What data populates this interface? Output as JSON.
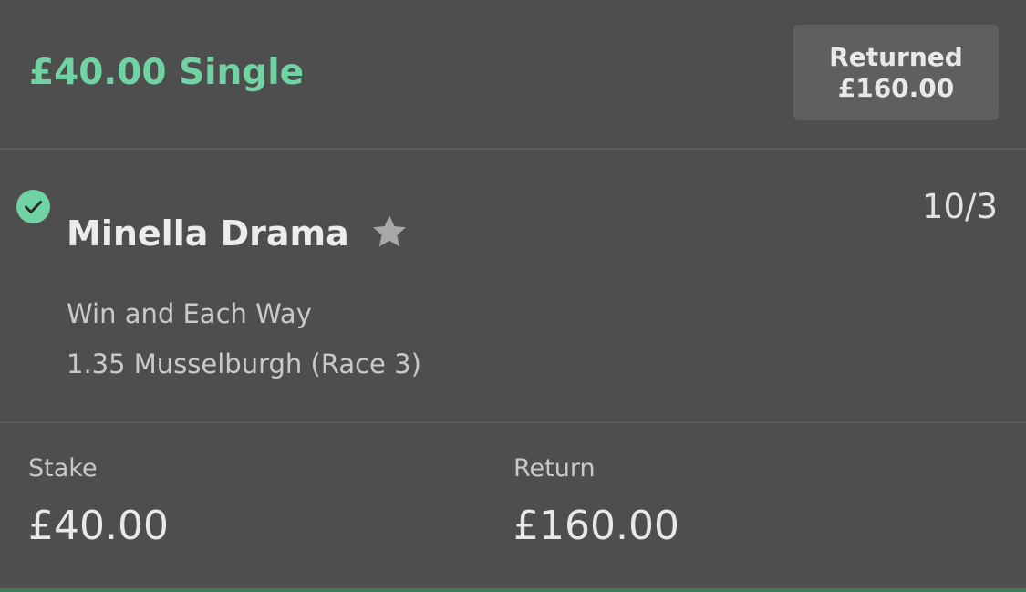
{
  "bet": {
    "title": "£40.00 Single",
    "status_label": "Returned",
    "status_amount": "£160.00"
  },
  "selection": {
    "status_icon": "check-circle-icon",
    "horse_name": "Minella Drama",
    "favourite_icon": "star-icon",
    "odds": "10/3",
    "market": "Win and Each Way",
    "race": "1.35 Musselburgh (Race 3)"
  },
  "summary": {
    "stake_label": "Stake",
    "stake_value": "£40.00",
    "return_label": "Return",
    "return_value": "£160.00"
  },
  "colors": {
    "background": "#4e4e4e",
    "accent": "#6fd3a4",
    "badge": "#5f5f5f"
  }
}
